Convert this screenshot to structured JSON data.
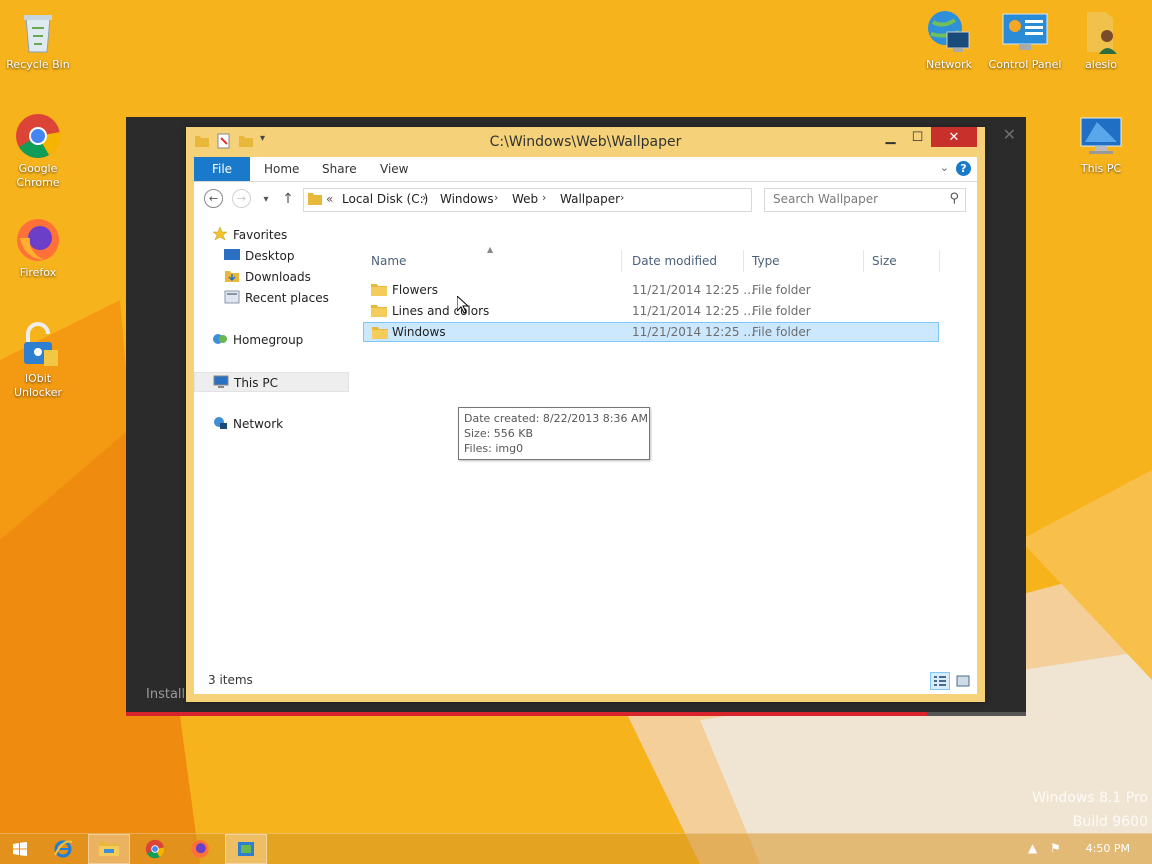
{
  "desktop": {
    "icons": [
      {
        "label": "Recycle Bin"
      },
      {
        "label": "Google Chrome"
      },
      {
        "label": "Firefox"
      },
      {
        "label": "IObit Unlocker"
      },
      {
        "label": "Network"
      },
      {
        "label": "Control Panel"
      },
      {
        "label": "alesio"
      },
      {
        "label": "This PC"
      }
    ],
    "watermark_line1": "Windows 8.1 Pro",
    "watermark_line2": "Build 9600"
  },
  "installer": {
    "status_text": "Installi",
    "progress": 0.89
  },
  "explorer": {
    "title": "C:\\Windows\\Web\\Wallpaper",
    "ribbon_tabs": [
      "File",
      "Home",
      "Share",
      "View"
    ],
    "breadcrumb": {
      "prefix": "«",
      "items": [
        "Local Disk (C:)",
        "Windows",
        "Web",
        "Wallpaper"
      ]
    },
    "search_placeholder": "Search Wallpaper",
    "nav": {
      "favorites": "Favorites",
      "desktop": "Desktop",
      "downloads": "Downloads",
      "recent": "Recent places",
      "homegroup": "Homegroup",
      "this_pc": "This PC",
      "network": "Network"
    },
    "columns": [
      "Name",
      "Date modified",
      "Type",
      "Size"
    ],
    "rows": [
      {
        "name": "Flowers",
        "date": "11/21/2014 12:25 ...",
        "type": "File folder"
      },
      {
        "name": "Lines and colors",
        "date": "11/21/2014 12:25 ...",
        "type": "File folder"
      },
      {
        "name": "Windows",
        "date": "11/21/2014 12:25 ...",
        "type": "File folder"
      }
    ],
    "tooltip": {
      "created": "Date created: 8/22/2013 8:36 AM",
      "size": "Size: 556 KB",
      "files": "Files: img0"
    },
    "status": "3 items"
  },
  "taskbar": {
    "clock": "4:50 PM"
  },
  "colors": {
    "accent": "#1979ca",
    "selection": "#cce8ff",
    "frame": "#f5d27a",
    "close": "#c7302b"
  }
}
